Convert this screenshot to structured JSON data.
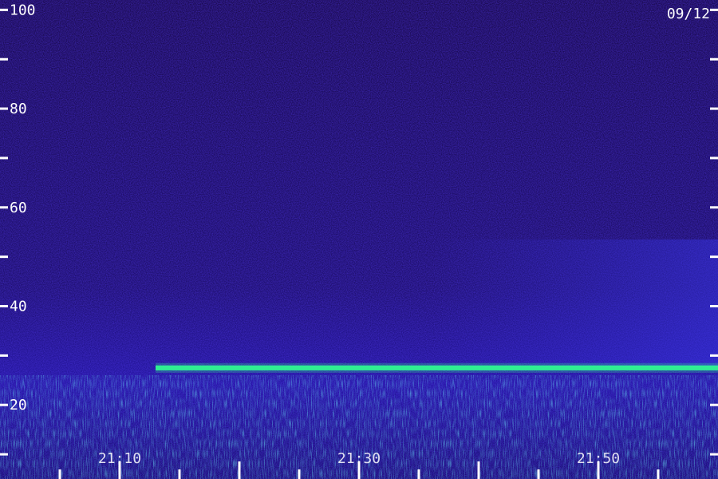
{
  "chart_data": {
    "type": "heatmap",
    "date_label": "09/12",
    "y_axis": {
      "tick_labels": [
        "100",
        "80",
        "60",
        "40",
        "20"
      ],
      "tick_values": [
        100,
        80,
        60,
        40,
        20
      ],
      "minor_tick_values": [
        90,
        70,
        50,
        30,
        10
      ],
      "ylim": [
        5,
        102
      ]
    },
    "x_axis": {
      "tick_labels": [
        "21:10",
        "21:30",
        "21:50"
      ],
      "xlim_minutes": [
        "21:00",
        "22:00"
      ]
    },
    "bands": [
      {
        "from": "21:13",
        "to": "22:00",
        "y_start": 27,
        "y_end": 28,
        "intensity": "high"
      }
    ],
    "colors": {
      "background_low": "#1a0a5e",
      "mid": "#2a2ad0",
      "high": "#30ff90",
      "axis": "#ffffff"
    },
    "grid": false
  }
}
